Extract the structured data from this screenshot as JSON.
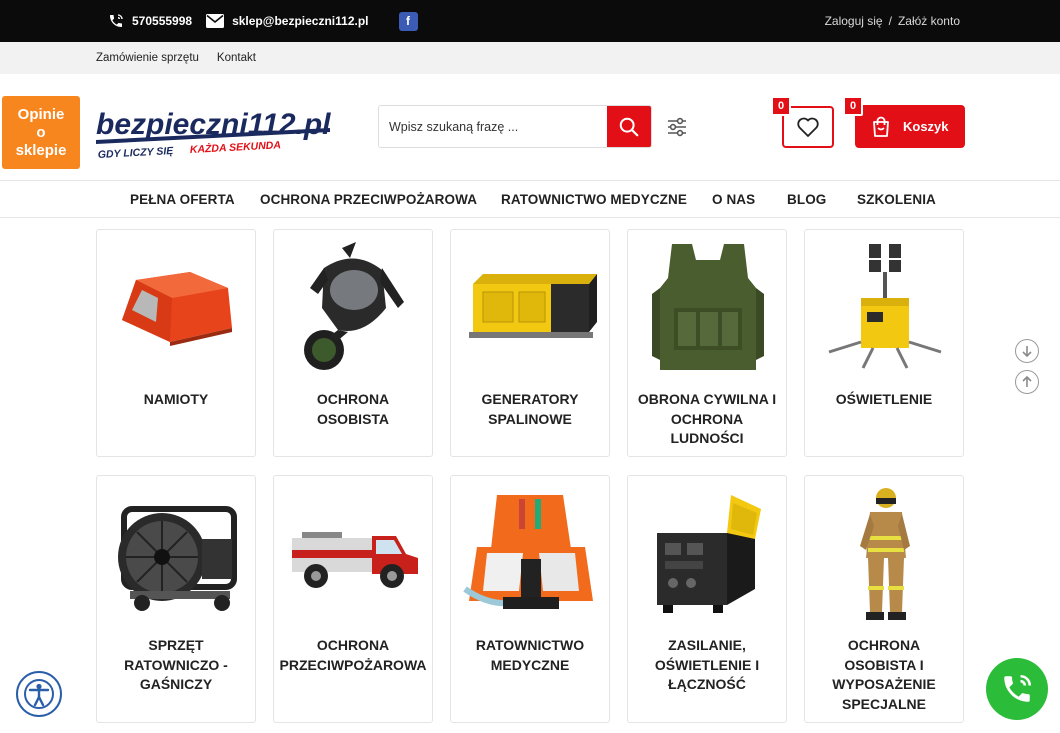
{
  "topbar": {
    "phone": "570555998",
    "email": "sklep@bezpieczni112.pl",
    "facebook_glyph": "f",
    "login": "Zaloguj się",
    "separator": "/",
    "register": "Załóż konto"
  },
  "subnav": {
    "order": "Zamówienie sprzętu",
    "contact": "Kontakt"
  },
  "opinie": {
    "line1": "Opinie",
    "line2": "o",
    "line3": "sklepie"
  },
  "logo": {
    "brand": "bezpieczni112.pl",
    "tagline_a": "GDY LICZY SIĘ",
    "tagline_b": "KAŻDA SEKUNDA"
  },
  "search": {
    "placeholder": "Wpisz szukaną frazę ..."
  },
  "header": {
    "wishlist_count": "0",
    "cart_count": "0",
    "cart_label": "Koszyk"
  },
  "mainnav": {
    "items": [
      "PEŁNA OFERTA",
      "OCHRONA PRZECIWPOŻAROWA",
      "RATOWNICTWO MEDYCZNE",
      "O NAS",
      "BLOG",
      "SZKOLENIA"
    ]
  },
  "categories": [
    {
      "l1": "NAMIOTY",
      "l2": "",
      "l3": "",
      "l4": "",
      "icon": "tent-image"
    },
    {
      "l1": "OCHRONA",
      "l2": "OSOBISTA",
      "l3": "",
      "l4": "",
      "icon": "gas-mask-image"
    },
    {
      "l1": "GENERATORY",
      "l2": "SPALINOWE",
      "l3": "",
      "l4": "",
      "icon": "generator-image"
    },
    {
      "l1": "OBRONA CYWILNA I",
      "l2": "OCHRONA",
      "l3": "LUDNOŚCI",
      "l4": "",
      "icon": "vest-image"
    },
    {
      "l1": "OŚWIETLENIE",
      "l2": "",
      "l3": "",
      "l4": "",
      "icon": "light-tower-image"
    },
    {
      "l1": "SPRZĘT",
      "l2": "RATOWNICZO -",
      "l3": "GAŚNICZY",
      "l4": "",
      "icon": "fan-image"
    },
    {
      "l1": "OCHRONA",
      "l2": "PRZECIWPOŻAROWA",
      "l3": "",
      "l4": "",
      "icon": "fire-truck-image"
    },
    {
      "l1": "RATOWNICTWO",
      "l2": "MEDYCZNE",
      "l3": "",
      "l4": "",
      "icon": "medical-bag-image"
    },
    {
      "l1": "ZASILANIE,",
      "l2": "OŚWIETLENIE I",
      "l3": "ŁĄCZNOŚĆ",
      "l4": "",
      "icon": "power-box-image"
    },
    {
      "l1": "OCHRONA",
      "l2": "OSOBISTA I",
      "l3": "WYPOSAŻENIE",
      "l4": "SPECJALNE",
      "icon": "firefighter-image"
    }
  ],
  "colors": {
    "brand_red": "#e30f16",
    "opinie_orange": "#f7861f",
    "phone_green": "#2bbd3a"
  }
}
